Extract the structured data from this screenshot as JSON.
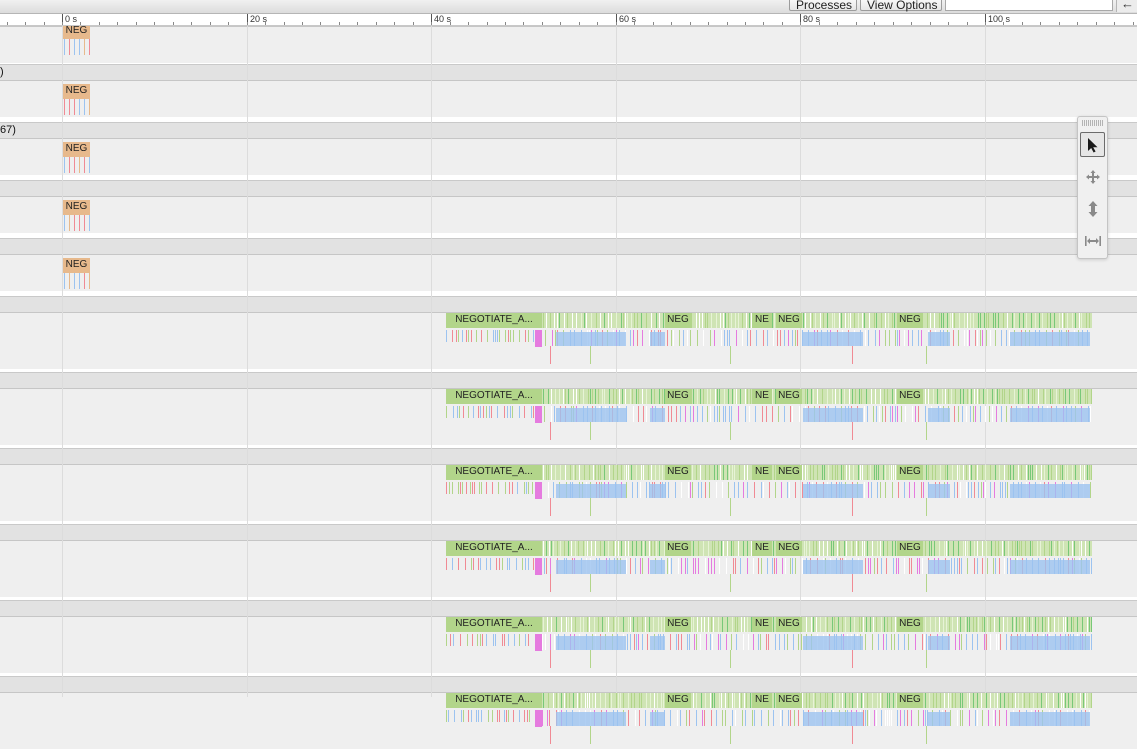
{
  "toolbar": {
    "processes_label": "Processes",
    "view_options_label": "View Options",
    "search": {
      "value": "",
      "placeholder": ""
    },
    "back_glyph": "←"
  },
  "timeline": {
    "tick_labels": [
      "0 s",
      "20 s",
      "40 s",
      "60 s",
      "80 s",
      "100 s"
    ],
    "slice_colors": {
      "negotiate_green": "#b2d58a",
      "neg_orange": "#e7b98c",
      "light_blue": "#9cc3f0",
      "pink": "#f08a94",
      "magenta": "#e57bdf",
      "dark_green": "#78c878"
    }
  },
  "process_bands": [
    {
      "label": ""
    },
    {
      "label": ")"
    },
    {
      "label": "67)"
    },
    {
      "label": ""
    },
    {
      "label": ""
    },
    {
      "label": ""
    },
    {
      "label": ""
    },
    {
      "label": ""
    },
    {
      "label": ""
    },
    {
      "label": ""
    },
    {
      "label": ""
    }
  ],
  "early_tracks": [
    {
      "slice_label": "NEG"
    },
    {
      "slice_label": "NEG"
    },
    {
      "slice_label": "NEG"
    },
    {
      "slice_label": "NEG"
    },
    {
      "slice_label": "NEG"
    }
  ],
  "late_tracks": [
    {
      "slices": [
        "NEGOTIATE_A...",
        "NEG",
        "NE",
        "NEG",
        "NEG"
      ]
    },
    {
      "slices": [
        "NEGOTIATE_A...",
        "NEG",
        "NE",
        "NEG",
        "NEG"
      ]
    },
    {
      "slices": [
        "NEGOTIATE_A...",
        "NEG",
        "NE",
        "NEG",
        "NEG"
      ]
    },
    {
      "slices": [
        "NEGOTIATE_A...",
        "NEG",
        "NE",
        "NEG",
        "NEG"
      ]
    },
    {
      "slices": [
        "NEGOTIATE_A...",
        "NEG",
        "NE",
        "NEG",
        "NEG"
      ]
    },
    {
      "slices": [
        "NEGOTIATE_A...",
        "NEG",
        "NE",
        "NEG",
        "NEG"
      ]
    }
  ],
  "tools": [
    {
      "icon": "pointer-icon",
      "active": true
    },
    {
      "icon": "pan-icon",
      "active": false
    },
    {
      "icon": "zoom-icon",
      "active": false
    },
    {
      "icon": "timing-icon",
      "active": false
    }
  ]
}
